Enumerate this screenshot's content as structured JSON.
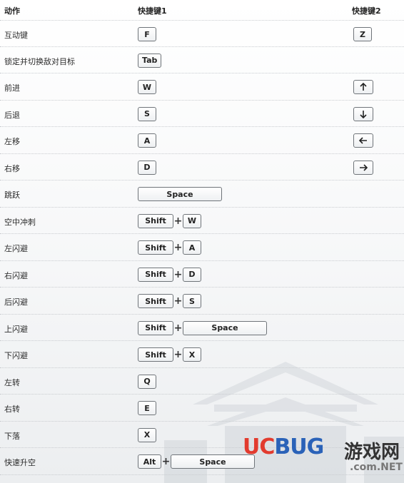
{
  "header": {
    "action": "动作",
    "key1": "快捷键1",
    "key2": "快捷键2"
  },
  "rows": [
    {
      "label": "互动键",
      "k1": [
        {
          "t": "F"
        }
      ],
      "k2": {
        "t": "Z"
      }
    },
    {
      "label": "锁定并切换敌对目标",
      "k1": [
        {
          "t": "Tab"
        }
      ],
      "k2": null
    },
    {
      "label": "前进",
      "k1": [
        {
          "t": "W"
        }
      ],
      "k2": {
        "icon": "arrow-up-icon"
      }
    },
    {
      "label": "后退",
      "k1": [
        {
          "t": "S"
        }
      ],
      "k2": {
        "icon": "arrow-down-icon"
      }
    },
    {
      "label": "左移",
      "k1": [
        {
          "t": "A"
        }
      ],
      "k2": {
        "icon": "arrow-left-icon"
      }
    },
    {
      "label": "右移",
      "k1": [
        {
          "t": "D"
        }
      ],
      "k2": {
        "icon": "arrow-right-icon"
      }
    },
    {
      "label": "跳跃",
      "k1": [
        {
          "t": "Space"
        }
      ],
      "k2": null
    },
    {
      "label": "空中冲刺",
      "k1": [
        {
          "t": "Shift"
        },
        {
          "t": "W"
        }
      ],
      "k2": null
    },
    {
      "label": "左闪避",
      "k1": [
        {
          "t": "Shift"
        },
        {
          "t": "A"
        }
      ],
      "k2": null
    },
    {
      "label": "右闪避",
      "k1": [
        {
          "t": "Shift"
        },
        {
          "t": "D"
        }
      ],
      "k2": null
    },
    {
      "label": "后闪避",
      "k1": [
        {
          "t": "Shift"
        },
        {
          "t": "S"
        }
      ],
      "k2": null
    },
    {
      "label": "上闪避",
      "k1": [
        {
          "t": "Shift"
        },
        {
          "t": "Space"
        }
      ],
      "k2": null
    },
    {
      "label": "下闪避",
      "k1": [
        {
          "t": "Shift"
        },
        {
          "t": "X"
        }
      ],
      "k2": null
    },
    {
      "label": "左转",
      "k1": [
        {
          "t": "Q"
        }
      ],
      "k2": null
    },
    {
      "label": "右转",
      "k1": [
        {
          "t": "E"
        }
      ],
      "k2": null
    },
    {
      "label": "下落",
      "k1": [
        {
          "t": "X"
        }
      ],
      "k2": null
    },
    {
      "label": "快速升空",
      "k1": [
        {
          "t": "Alt"
        },
        {
          "t": "Space"
        }
      ],
      "k2": null
    }
  ],
  "plus_sign": "+",
  "watermark": {
    "logo_uc": "UC",
    "logo_bug": "BUG",
    "logo_cn": "游戏网",
    "domain": ".com.NET"
  }
}
